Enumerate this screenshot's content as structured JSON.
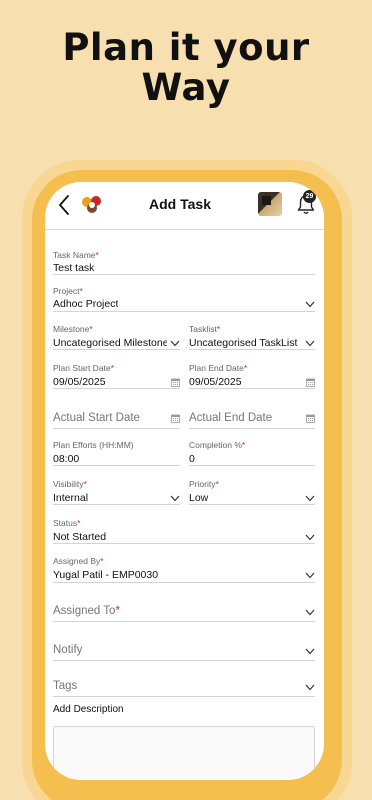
{
  "headline": {
    "line1": "Plan it your",
    "line2": "Way"
  },
  "appbar": {
    "title": "Add Task",
    "notification_count": "29"
  },
  "form": {
    "task_name": {
      "label": "Task Name",
      "value": "Test task"
    },
    "project": {
      "label": "Project",
      "value": "Adhoc Project"
    },
    "milestone": {
      "label": "Milestone",
      "value": "Uncategorised Milestone"
    },
    "tasklist": {
      "label": "Tasklist",
      "value": "Uncategorised TaskList"
    },
    "plan_start": {
      "label": "Plan Start Date",
      "value": "09/05/2025"
    },
    "plan_end": {
      "label": "Plan End Date",
      "value": "09/05/2025"
    },
    "actual_start": {
      "placeholder": "Actual Start Date"
    },
    "actual_end": {
      "placeholder": "Actual End Date"
    },
    "plan_efforts": {
      "label": "Plan Efforts (HH:MM)",
      "value": "08:00"
    },
    "completion": {
      "label": "Completion %",
      "value": "0"
    },
    "visibility": {
      "label": "Visibility",
      "value": "Internal"
    },
    "priority": {
      "label": "Priority",
      "value": "Low"
    },
    "status": {
      "label": "Status",
      "value": "Not Started"
    },
    "assigned_by": {
      "label": "Assigned By",
      "value": "Yugal Patil - EMP0030"
    },
    "assigned_to": {
      "placeholder": "Assigned To"
    },
    "notify": {
      "placeholder": "Notify"
    },
    "tags": {
      "placeholder": "Tags"
    },
    "description": {
      "label": "Add Description"
    }
  },
  "colors": {
    "background": "#f8dfb0",
    "frame": "#f5bf4f",
    "required": "#dd2222"
  },
  "icons": [
    "back-arrow-icon",
    "app-logo-icon",
    "bell-icon",
    "chevron-down-icon",
    "calendar-icon"
  ]
}
